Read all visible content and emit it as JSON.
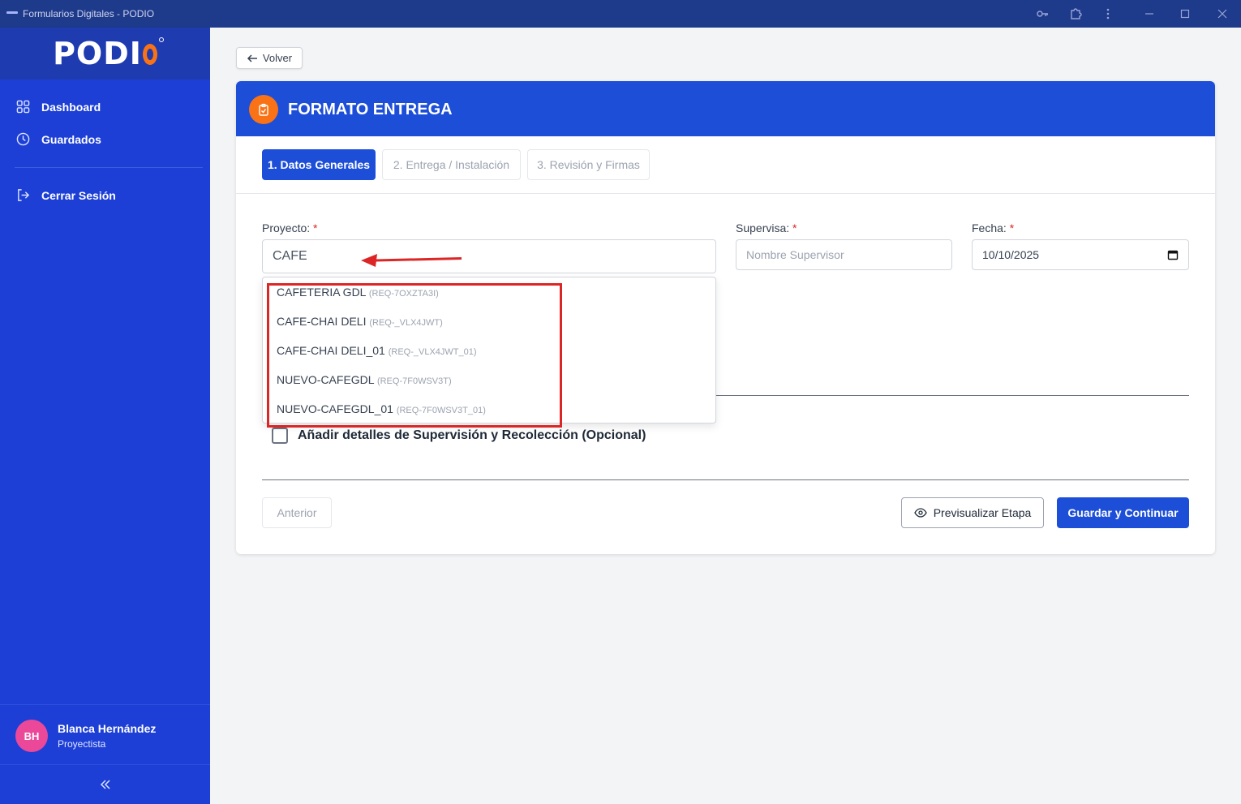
{
  "window": {
    "title": "Formularios Digitales - PODIO"
  },
  "sidebar": {
    "brand": "PODI",
    "items": [
      {
        "label": "Dashboard",
        "icon": "grid-icon"
      },
      {
        "label": "Guardados",
        "icon": "clock-icon"
      },
      {
        "label": "Cerrar Sesión",
        "icon": "logout-icon"
      }
    ],
    "user": {
      "initials": "BH",
      "name": "Blanca Hernández",
      "role": "Proyectista"
    }
  },
  "main": {
    "back_label": "Volver",
    "form_title": "FORMATO ENTREGA",
    "steps": [
      {
        "label": "1. Datos Generales",
        "active": true
      },
      {
        "label": "2. Entrega / Instalación",
        "active": false
      },
      {
        "label": "3. Revisión y Firmas",
        "active": false
      }
    ],
    "fields": {
      "proyecto_label": "Proyecto:",
      "proyecto_value": "CAFE",
      "supervisa_label": "Supervisa:",
      "supervisa_placeholder": "Nombre Supervisor",
      "fecha_label": "Fecha:",
      "fecha_value": "10/10/2025",
      "required_mark": "*"
    },
    "dropdown_options": [
      {
        "name": "CAFETERIA GDL",
        "code": "(REQ-7OXZTA3I)"
      },
      {
        "name": "CAFE-CHAI DELI",
        "code": "(REQ-_VLX4JWT)"
      },
      {
        "name": "CAFE-CHAI DELI_01",
        "code": "(REQ-_VLX4JWT_01)"
      },
      {
        "name": "NUEVO-CAFEGDL",
        "code": "(REQ-7F0WSV3T)"
      },
      {
        "name": "NUEVO-CAFEGDL_01",
        "code": "(REQ-7F0WSV3T_01)"
      }
    ],
    "checkbox_label": "Añadir detalles de Supervisión y Recolección (Opcional)",
    "buttons": {
      "prev": "Anterior",
      "preview": "Previsualizar Etapa",
      "save": "Guardar y Continuar"
    }
  },
  "colors": {
    "sidebar": "#1d3fd6",
    "header": "#1d4ed8",
    "accent_orange": "#f97316",
    "annotation_red": "#dc2626",
    "avatar": "#ec4899"
  }
}
